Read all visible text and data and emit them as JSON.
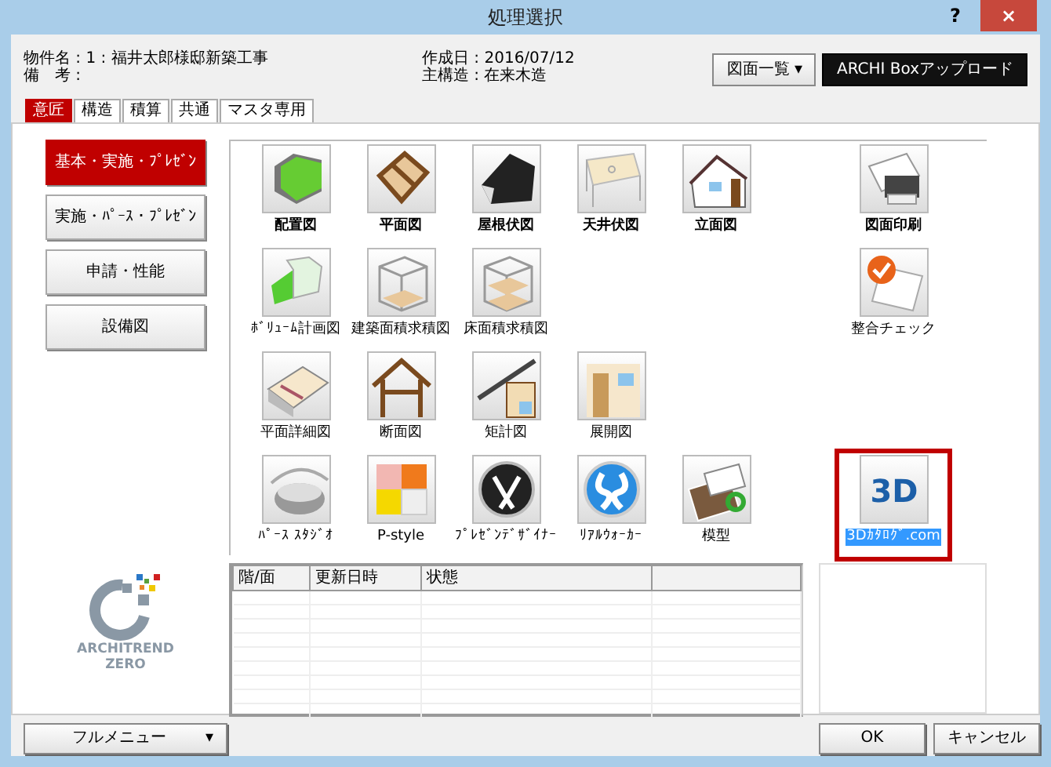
{
  "window": {
    "title": "処理選択",
    "help": "?",
    "close": "×"
  },
  "info": {
    "left": [
      "物件名 : 1 : 福井太郎様邸新築工事",
      "備　考 :"
    ],
    "right": [
      "作成日 : 2016/07/12",
      "主構造 : 在来木造"
    ]
  },
  "header_buttons": [
    {
      "label": "図面一覧",
      "caret": "▾",
      "kind": "menu"
    },
    {
      "label": "ARCHI Boxアップロード",
      "kind": "dark"
    }
  ],
  "tabs": [
    {
      "label": "意匠",
      "selected": true
    },
    {
      "label": "構造",
      "selected": false
    },
    {
      "label": "積算",
      "selected": false
    },
    {
      "label": "共通",
      "selected": false
    },
    {
      "label": "マスタ専用",
      "selected": false
    }
  ],
  "categories": [
    {
      "label": "基本・実施・ﾌﾟﾚｾﾞﾝ",
      "selected": true
    },
    {
      "label": "実施・ﾊﾟｰｽ・ﾌﾟﾚｾﾞﾝ",
      "selected": false
    },
    {
      "label": "申請・性能",
      "selected": false
    },
    {
      "label": "設備図",
      "selected": false
    }
  ],
  "tool_rows": [
    {
      "items": [
        {
          "label": "配置図",
          "selected": false
        },
        {
          "label": "平面図",
          "selected": false
        },
        {
          "label": "屋根伏図",
          "selected": false
        },
        {
          "label": "天井伏図",
          "selected": false
        },
        {
          "label": "立面図",
          "selected": false
        }
      ],
      "side": {
        "label": "図面印刷",
        "selected": false
      }
    },
    {
      "items": [
        {
          "label": "ﾎﾞﾘｭｰﾑ計画図",
          "selected": false
        },
        {
          "label": "建築面積求積図",
          "selected": false
        },
        {
          "label": "床面積求積図",
          "selected": false
        }
      ],
      "side": {
        "label": "整合チェック",
        "selected": false
      }
    },
    {
      "items": [
        {
          "label": "平面詳細図",
          "selected": false
        },
        {
          "label": "断面図",
          "selected": false
        },
        {
          "label": "矩計図",
          "selected": false
        },
        {
          "label": "展開図",
          "selected": false
        }
      ]
    },
    {
      "items": [
        {
          "label": "ﾊﾟｰｽ ｽﾀｼﾞｵ",
          "selected": false
        },
        {
          "label": "P-style",
          "selected": false
        },
        {
          "label": "ﾌﾟﾚｾﾞﾝﾃﾞｻﾞｲﾅｰ",
          "selected": false
        },
        {
          "label": "ﾘｱﾙｳｫｰｶｰ",
          "selected": false
        },
        {
          "label": "模型",
          "selected": false
        }
      ],
      "side": {
        "label": "3Dｶﾀﾛｸﾞ.com",
        "logo_text": "3D",
        "selected": true
      }
    }
  ],
  "table": {
    "columns": [
      "階/面",
      "更新日時",
      "状態"
    ]
  },
  "logo": {
    "lines": [
      "ARCHITREND",
      "ZERO"
    ]
  },
  "footer": {
    "menu": {
      "label": "フルメニュー",
      "caret": "▾"
    },
    "buttons": [
      "OK",
      "キャンセル"
    ]
  }
}
